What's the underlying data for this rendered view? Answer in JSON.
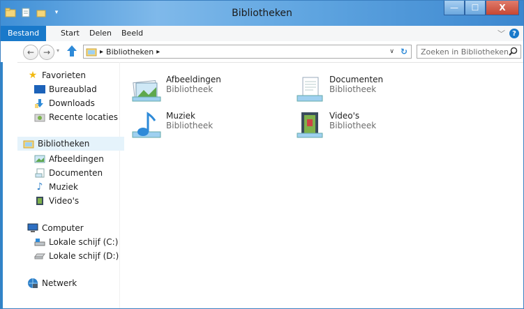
{
  "window": {
    "title": "Bibliotheken",
    "minimize": "—",
    "maximize": "☐",
    "close": "X"
  },
  "ribbon": {
    "tabs": [
      "Bestand",
      "Start",
      "Delen",
      "Beeld"
    ]
  },
  "address": {
    "path_sep": "▸",
    "path": "Bibliotheken",
    "path_sep2": "▸",
    "search_placeholder": "Zoeken in Bibliotheken"
  },
  "sidebar": {
    "favorites": {
      "label": "Favorieten",
      "items": [
        "Bureaublad",
        "Downloads",
        "Recente locaties"
      ]
    },
    "libraries": {
      "label": "Bibliotheken",
      "items": [
        "Afbeeldingen",
        "Documenten",
        "Muziek",
        "Video's"
      ]
    },
    "computer": {
      "label": "Computer",
      "items": [
        "Lokale schijf (C:)",
        "Lokale schijf (D:)"
      ]
    },
    "network": {
      "label": "Netwerk"
    }
  },
  "libraries": [
    {
      "name": "Afbeeldingen",
      "type": "Bibliotheek",
      "icon": "pictures-library-icon"
    },
    {
      "name": "Documenten",
      "type": "Bibliotheek",
      "icon": "documents-library-icon"
    },
    {
      "name": "Muziek",
      "type": "Bibliotheek",
      "icon": "music-library-icon"
    },
    {
      "name": "Video's",
      "type": "Bibliotheek",
      "icon": "videos-library-icon"
    }
  ],
  "colors": {
    "accent": "#1979ca",
    "selection": "#e5f3fb",
    "secondary_text": "#6d6d6d"
  }
}
